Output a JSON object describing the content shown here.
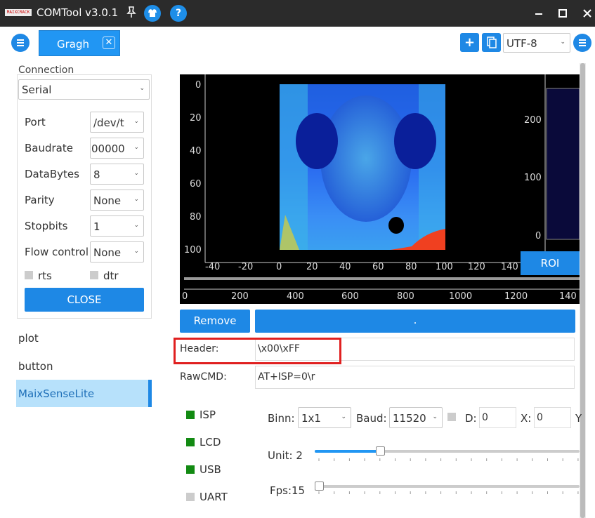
{
  "window": {
    "title": "COMTool v3.0.1",
    "logo_text": "MAIXCRACK",
    "colors": {
      "titlebar": "#2b2b2b",
      "accent": "#1e88e5",
      "highlight": "#e02020",
      "status_on": "#128a12"
    }
  },
  "toolbar": {
    "tab_label": "Gragh",
    "encoding": "UTF-8"
  },
  "connection": {
    "group_label": "Connection",
    "type": "Serial",
    "fields": [
      {
        "label": "Port",
        "value": "/dev/t"
      },
      {
        "label": "Baudrate",
        "value": "00000"
      },
      {
        "label": "DataBytes",
        "value": "8"
      },
      {
        "label": "Parity",
        "value": "None"
      },
      {
        "label": "Stopbits",
        "value": "1"
      },
      {
        "label": "Flow control",
        "value": "None"
      }
    ],
    "rts_label": "rts",
    "dtr_label": "dtr",
    "close_label": "CLOSE"
  },
  "sidebar": {
    "items": [
      {
        "label": "plot"
      },
      {
        "label": "button"
      },
      {
        "label": "MaixSenseLite"
      }
    ]
  },
  "plot": {
    "x_ticks_top": [
      "-40",
      "-20",
      "0",
      "20",
      "40",
      "60",
      "80",
      "100",
      "120",
      "140"
    ],
    "y_ticks_left": [
      "0",
      "20",
      "40",
      "60",
      "80",
      "100"
    ],
    "y_ticks_right": [
      "200",
      "100",
      "0"
    ],
    "x_ticks_bottom": [
      "0",
      "200",
      "400",
      "600",
      "800",
      "1000",
      "1200",
      "140"
    ],
    "roi_label": "ROI"
  },
  "actions": {
    "remove_label": "Remove",
    "dot_label": "."
  },
  "fields": {
    "header_label": "Header:",
    "header_value": "\\x00\\xFF",
    "rawcmd_label": "RawCMD:",
    "rawcmd_value": "AT+ISP=0\\r"
  },
  "controls": {
    "toggles": [
      {
        "label": "ISP",
        "on": true
      },
      {
        "label": "LCD",
        "on": true
      },
      {
        "label": "USB",
        "on": true
      },
      {
        "label": "UART",
        "on": false
      }
    ],
    "binn_label": "Binn:",
    "binn_value": "1x1",
    "baud_label": "Baud:",
    "baud_value": "11520",
    "d_label": "D:",
    "d_value": "0",
    "x_label": "X:",
    "x_value": "0",
    "y_label": "Y",
    "unit_label": "Unit: 2",
    "unit_level": 0.24,
    "fps_label": "Fps:15",
    "fps_level": 0.0
  }
}
